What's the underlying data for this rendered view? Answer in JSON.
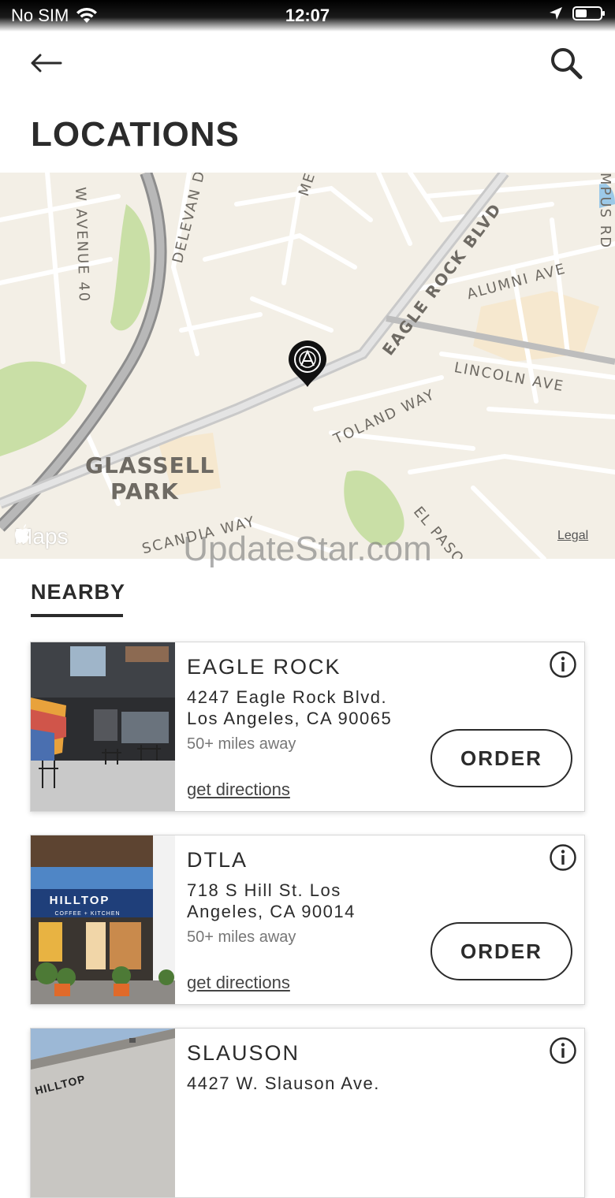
{
  "status_bar": {
    "carrier": "No SIM",
    "time": "12:07"
  },
  "header": {
    "title": "LOCATIONS"
  },
  "map": {
    "street_labels": [
      "W AVENUE 40",
      "DELEVAN DR",
      "ME",
      "EAGLE ROCK BLVD",
      "ALUMNI AVE",
      "LINCOLN AVE",
      "TOLAND WAY",
      "GLASSELL",
      "PARK",
      "SCANDIA WAY",
      "EL PASO",
      "MPUS RD"
    ],
    "brand": "Maps",
    "legal": "Legal",
    "watermark": "UpdateStar.com"
  },
  "nearby": {
    "tab_label": "NEARBY"
  },
  "locations": [
    {
      "name": "EAGLE ROCK",
      "address_line1": "4247 Eagle Rock Blvd.",
      "address_line2": "Los Angeles, CA 90065",
      "distance": "50+ miles away",
      "directions": "get directions",
      "order": "ORDER"
    },
    {
      "name": "DTLA",
      "address_line1": "718 S Hill St. Los",
      "address_line2": "Angeles, CA 90014",
      "distance": "50+ miles away",
      "directions": "get directions",
      "order": "ORDER"
    },
    {
      "name": "SLAUSON",
      "address_line1": "4427 W. Slauson Ave.",
      "address_line2": "",
      "distance": "",
      "directions": "",
      "order": ""
    }
  ],
  "photo_signage": {
    "hilltop": "HILLTOP",
    "coffee_kitchen": "COFFEE + KITCHEN"
  },
  "colors": {
    "text": "#2b2b2b",
    "map_bg": "#f3efe6",
    "park_green": "#c9dfa6",
    "highway": "#a9a9a9"
  },
  "icons": {
    "back": "arrow-left-icon",
    "search": "search-icon",
    "info": "info-icon",
    "pin": "map-pin-icon"
  }
}
